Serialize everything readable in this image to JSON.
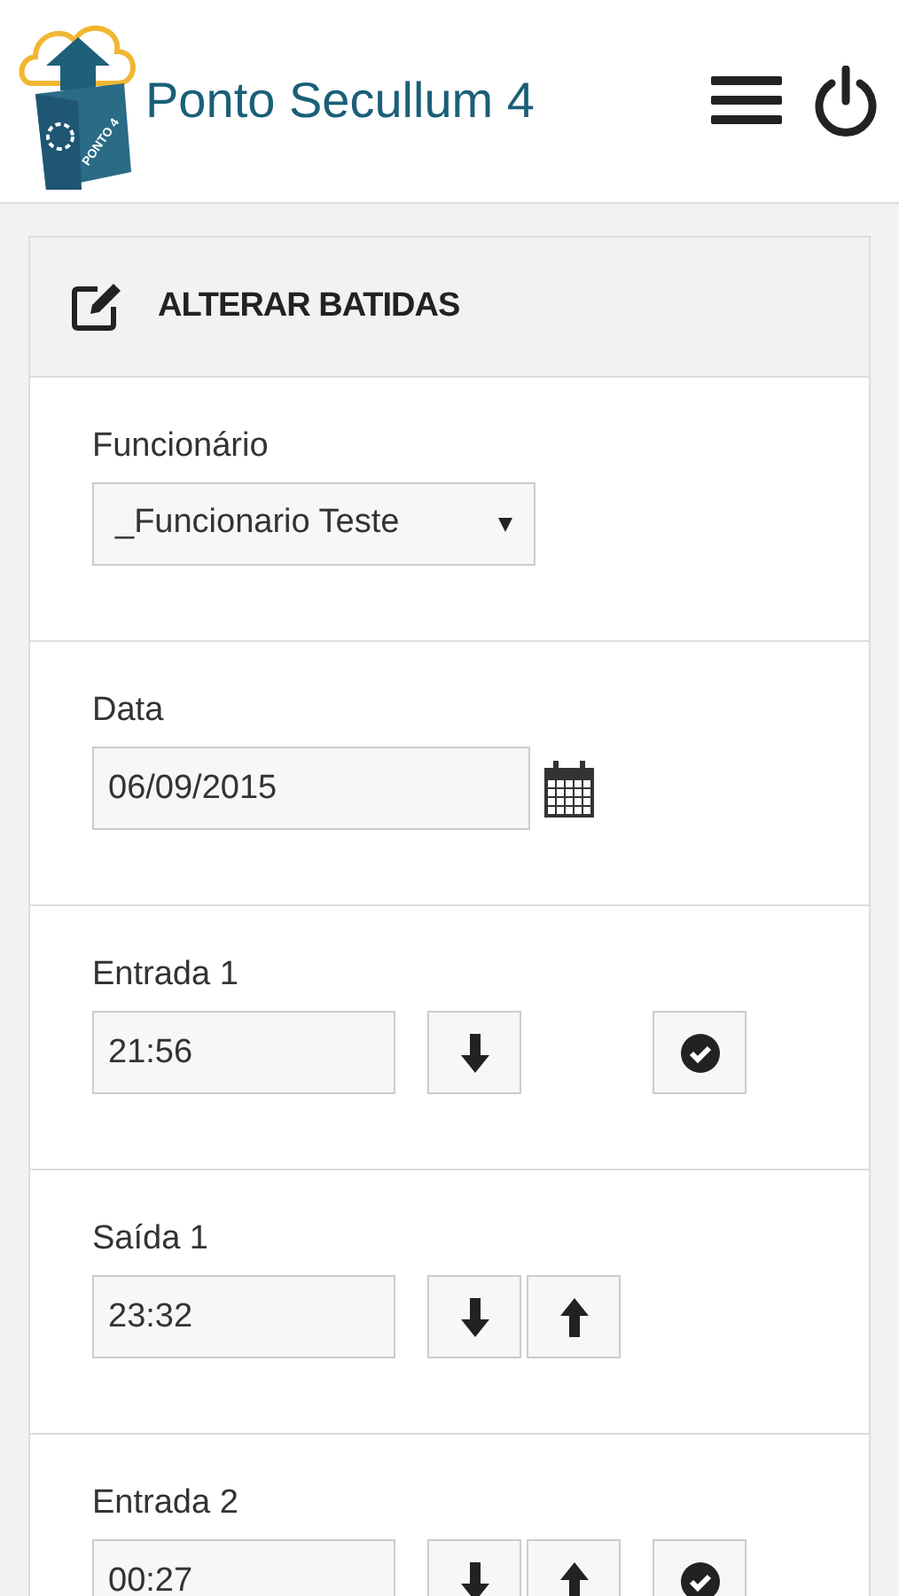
{
  "header": {
    "logo_text": "PONTO 4",
    "title": "Ponto Secullum 4"
  },
  "panel": {
    "title": "ALTERAR BATIDAS"
  },
  "rows": [
    {
      "kind": "select",
      "label": "Funcionário",
      "value": "_Funcionario Teste"
    },
    {
      "kind": "date",
      "label": "Data",
      "value": "06/09/2015"
    },
    {
      "kind": "time",
      "label": "Entrada 1",
      "value": "21:56",
      "down": true,
      "up": false,
      "confirm": true
    },
    {
      "kind": "time",
      "label": "Saída 1",
      "value": "23:32",
      "down": true,
      "up": true,
      "confirm": false
    },
    {
      "kind": "time",
      "label": "Entrada 2",
      "value": "00:27",
      "down": true,
      "up": true,
      "confirm": true
    }
  ]
}
